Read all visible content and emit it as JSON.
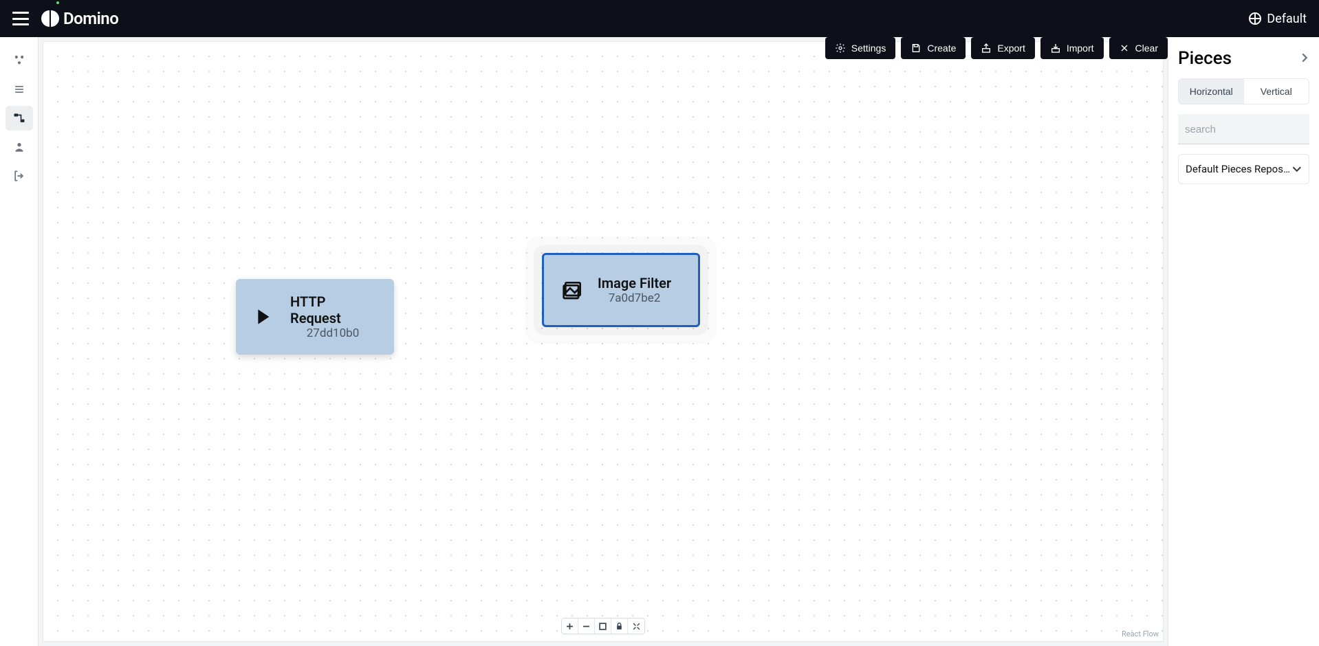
{
  "topbar": {
    "brand": "Domino",
    "workspace": "Default"
  },
  "toolbar": {
    "settings": "Settings",
    "create": "Create",
    "export": "Export",
    "import": "Import",
    "clear": "Clear"
  },
  "nodes": {
    "http": {
      "title": "HTTP Request",
      "id": "27dd10b0"
    },
    "imgf": {
      "title": "Image Filter",
      "id": "7a0d7be2"
    }
  },
  "canvas": {
    "attribution": "React Flow"
  },
  "side_panel": {
    "title": "Pieces",
    "tabs": {
      "horizontal": "Horizontal",
      "vertical": "Vertical"
    },
    "search_placeholder": "search",
    "repo_selected": "Default Pieces Reposit…"
  }
}
